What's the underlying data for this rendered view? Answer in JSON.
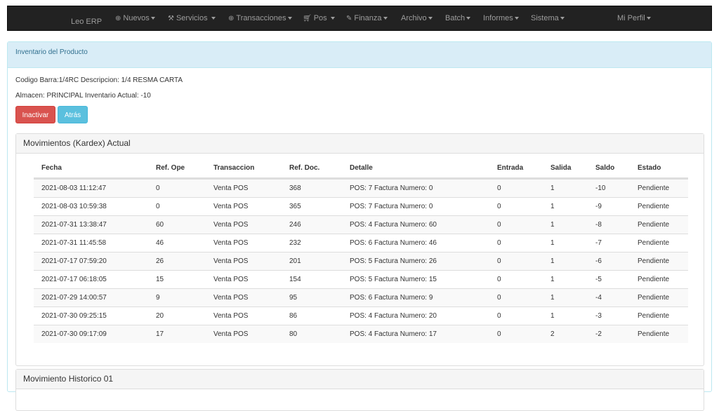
{
  "navbar": {
    "brand": "Leo ERP",
    "items": [
      {
        "label": "Nuevos",
        "icon": "plus-circle-icon"
      },
      {
        "label": "Servicios",
        "icon": "wrench-icon"
      },
      {
        "label": "Transacciones",
        "icon": "plus-circle-icon"
      },
      {
        "label": "Pos",
        "icon": "cart-icon"
      },
      {
        "label": "Finanza",
        "icon": "edit-icon"
      },
      {
        "label": "Archivo",
        "icon": ""
      },
      {
        "label": "Batch",
        "icon": ""
      },
      {
        "label": "Informes",
        "icon": ""
      },
      {
        "label": "Sistema",
        "icon": ""
      },
      {
        "label": "Mi Perfil",
        "icon": ""
      }
    ]
  },
  "product_panel": {
    "title": "Inventario del Producto",
    "line1": "Codigo Barra:1/4RC Descripcion: 1/4 RESMA CARTA",
    "line2": "Almacen: PRINCIPAL Inventario Actual: -10",
    "inactivar_label": "Inactivar",
    "atras_label": "Atrás"
  },
  "kardex": {
    "title": "Movimientos (Kardex) Actual",
    "columns": [
      "Fecha",
      "Ref. Ope",
      "Transaccion",
      "Ref. Doc.",
      "Detalle",
      "Entrada",
      "Salida",
      "Saldo",
      "Estado"
    ],
    "rows": [
      [
        "2021-08-03 11:12:47",
        "0",
        "Venta POS",
        "368",
        "POS: 7 Factura Numero: 0",
        "0",
        "1",
        "-10",
        "Pendiente"
      ],
      [
        "2021-08-03 10:59:38",
        "0",
        "Venta POS",
        "365",
        "POS: 7 Factura Numero: 0",
        "0",
        "1",
        "-9",
        "Pendiente"
      ],
      [
        "2021-07-31 13:38:47",
        "60",
        "Venta POS",
        "246",
        "POS: 4 Factura Numero: 60",
        "0",
        "1",
        "-8",
        "Pendiente"
      ],
      [
        "2021-07-31 11:45:58",
        "46",
        "Venta POS",
        "232",
        "POS: 6 Factura Numero: 46",
        "0",
        "1",
        "-7",
        "Pendiente"
      ],
      [
        "2021-07-17 07:59:20",
        "26",
        "Venta POS",
        "201",
        "POS: 5 Factura Numero: 26",
        "0",
        "1",
        "-6",
        "Pendiente"
      ],
      [
        "2021-07-17 06:18:05",
        "15",
        "Venta POS",
        "154",
        "POS: 5 Factura Numero: 15",
        "0",
        "1",
        "-5",
        "Pendiente"
      ],
      [
        "2021-07-29 14:00:57",
        "9",
        "Venta POS",
        "95",
        "POS: 6 Factura Numero: 9",
        "0",
        "1",
        "-4",
        "Pendiente"
      ],
      [
        "2021-07-30 09:25:15",
        "20",
        "Venta POS",
        "86",
        "POS: 4 Factura Numero: 20",
        "0",
        "1",
        "-3",
        "Pendiente"
      ],
      [
        "2021-07-30 09:17:09",
        "17",
        "Venta POS",
        "80",
        "POS: 4 Factura Numero: 17",
        "0",
        "2",
        "-2",
        "Pendiente"
      ]
    ]
  },
  "historico": {
    "title": "Movimiento Historico 01"
  },
  "colors": {
    "navbar": "#222222",
    "info_heading": "#d9edf7",
    "danger": "#d9534f",
    "info": "#5bc0de"
  }
}
